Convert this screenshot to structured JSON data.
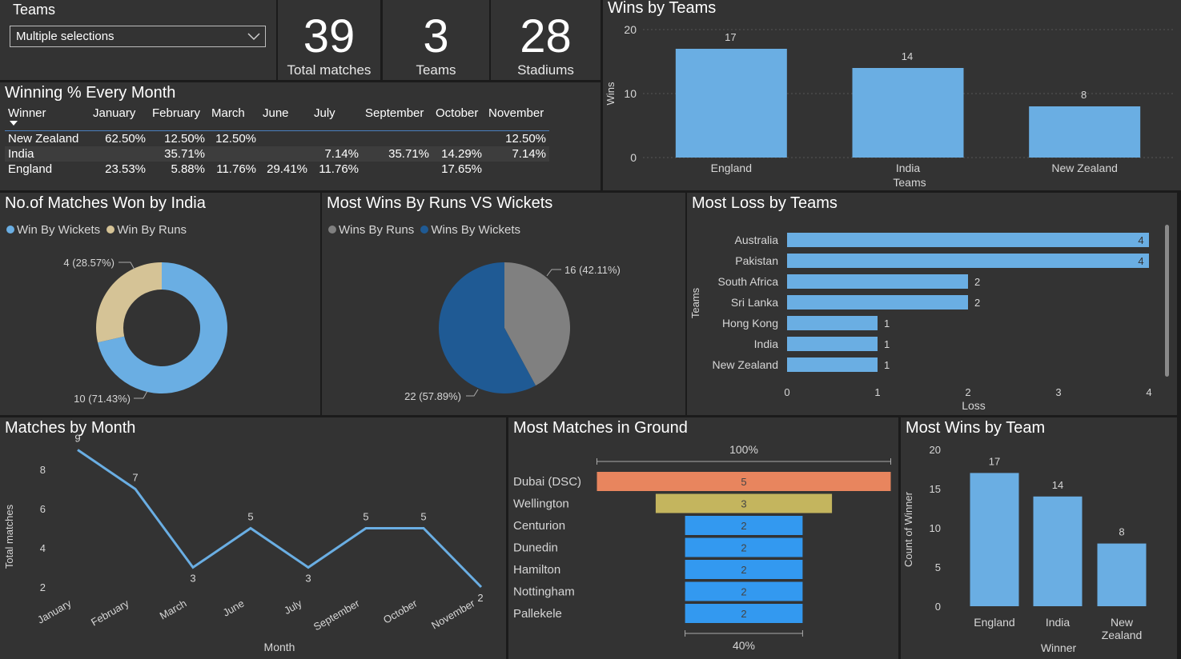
{
  "slicer": {
    "title": "Teams",
    "value": "Multiple selections"
  },
  "cards": [
    {
      "value": "39",
      "label": "Total matches"
    },
    {
      "value": "3",
      "label": "Teams"
    },
    {
      "value": "28",
      "label": "Stadiums"
    }
  ],
  "matrix": {
    "title": "Winning % Every Month",
    "columns": [
      "Winner",
      "January",
      "February",
      "March",
      "June",
      "July",
      "September",
      "October",
      "November"
    ],
    "rows": [
      {
        "cells": [
          "New Zealand",
          "62.50%",
          "12.50%",
          "12.50%",
          "",
          "",
          "",
          "",
          "12.50%"
        ]
      },
      {
        "cells": [
          "India",
          "",
          "35.71%",
          "",
          "",
          "7.14%",
          "35.71%",
          "14.29%",
          "7.14%"
        ]
      },
      {
        "cells": [
          "England",
          "23.53%",
          "5.88%",
          "11.76%",
          "29.41%",
          "11.76%",
          "",
          "17.65%",
          ""
        ]
      }
    ]
  },
  "colors": {
    "light_blue": "#6aaee3",
    "tan": "#d5c396",
    "grey": "#808080",
    "dark_blue": "#1f5a94",
    "bar_blue": "#6aaee3",
    "funnel_orange": "#e8855e",
    "funnel_olive": "#c4b55e",
    "funnel_blue": "#3399f0"
  },
  "chart_data": [
    {
      "id": "wins_by_teams",
      "type": "bar",
      "title": "Wins by Teams",
      "categories": [
        "England",
        "India",
        "New Zealand"
      ],
      "values": [
        17,
        14,
        8
      ],
      "xlabel": "Teams",
      "ylabel": "Wins",
      "ylim": [
        0,
        20
      ],
      "yticks": [
        "0",
        "10",
        "20"
      ],
      "grid": true
    },
    {
      "id": "india_wins",
      "type": "pie",
      "title": "No.of Matches Won by India",
      "legend": [
        "Win By Wickets",
        "Win By Runs"
      ],
      "slices": [
        {
          "name": "Win By Wickets",
          "value": 10,
          "label": "10 (71.43%)"
        },
        {
          "name": "Win By Runs",
          "value": 4,
          "label": "4 (28.57%)"
        }
      ]
    },
    {
      "id": "runs_vs_wickets",
      "type": "pie",
      "title": "Most Wins By Runs VS Wickets",
      "legend": [
        "Wins By Runs",
        "Wins By Wickets"
      ],
      "slices": [
        {
          "name": "Wins By Runs",
          "value": 16,
          "label": "16 (42.11%)"
        },
        {
          "name": "Wins By Wickets",
          "value": 22,
          "label": "22 (57.89%)"
        }
      ]
    },
    {
      "id": "loss_by_teams",
      "type": "bar",
      "title": "Most Loss by Teams",
      "categories": [
        "Australia",
        "Pakistan",
        "South Africa",
        "Sri Lanka",
        "Hong Kong",
        "India",
        "New Zealand"
      ],
      "values": [
        4,
        4,
        2,
        2,
        1,
        1,
        1
      ],
      "xlabel": "Loss",
      "ylabel": "Teams",
      "xlim": [
        0,
        4
      ],
      "xticks": [
        "0",
        "1",
        "2",
        "3",
        "4"
      ]
    },
    {
      "id": "matches_by_month",
      "type": "line",
      "title": "Matches by Month",
      "categories": [
        "January",
        "February",
        "March",
        "June",
        "July",
        "September",
        "October",
        "November"
      ],
      "values": [
        9,
        7,
        3,
        5,
        3,
        5,
        5,
        2
      ],
      "xlabel": "Month",
      "ylabel": "Total matches",
      "ylim": [
        2,
        9
      ],
      "yticks": [
        "2",
        "4",
        "6",
        "8"
      ]
    },
    {
      "id": "matches_in_ground",
      "type": "bar",
      "title": "Most Matches in Ground",
      "categories": [
        "Dubai (DSC)",
        "Wellington",
        "Centurion",
        "Dunedin",
        "Hamilton",
        "Nottingham",
        "Pallekele"
      ],
      "values": [
        5,
        3,
        2,
        2,
        2,
        2,
        2
      ],
      "top_label": "100%",
      "bottom_label": "40%"
    },
    {
      "id": "wins_by_team",
      "type": "bar",
      "title": "Most Wins by Team",
      "categories": [
        "England",
        "India",
        "New Zealand"
      ],
      "values": [
        17,
        14,
        8
      ],
      "xlabel": "Winner",
      "ylabel": "Count of Winner",
      "ylim": [
        0,
        20
      ],
      "yticks": [
        "0",
        "5",
        "10",
        "15",
        "20"
      ]
    }
  ]
}
